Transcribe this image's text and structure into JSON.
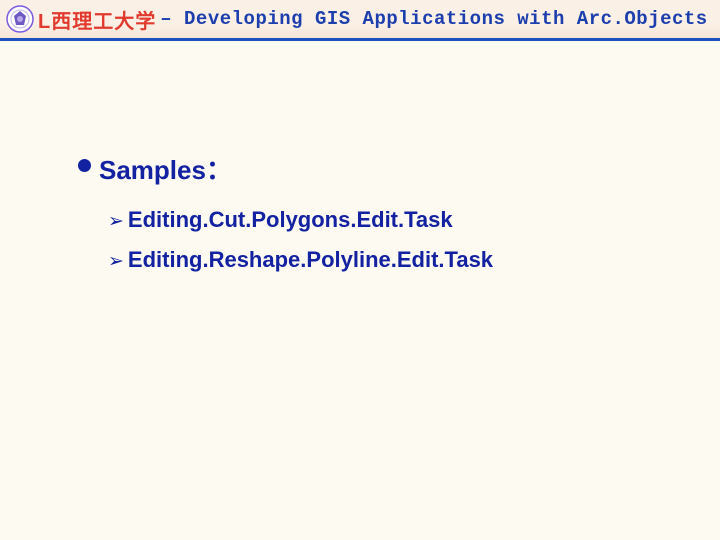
{
  "header": {
    "university_name_fragment": "L西理工大学",
    "separator": " – ",
    "course_title": "Developing GIS Applications with Arc.Objects using C#. NE"
  },
  "content": {
    "heading": "Samples：",
    "items": [
      "Editing.Cut.Polygons.Edit.Task",
      "Editing.Reshape.Polyline.Edit.Task"
    ]
  }
}
